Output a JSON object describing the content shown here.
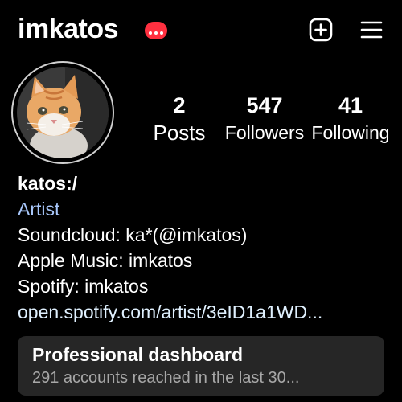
{
  "header": {
    "username": "imkatos",
    "create_icon": "plus-square-icon",
    "menu_icon": "hamburger-menu-icon",
    "badge_color": "#ff3040"
  },
  "profile": {
    "avatar_icon": "cat-avatar",
    "stats": {
      "posts": {
        "value": "2",
        "label": "Posts"
      },
      "followers": {
        "value": "547",
        "label": "Followers"
      },
      "following": {
        "value": "41",
        "label": "Following"
      }
    }
  },
  "bio": {
    "name": "katos:/",
    "category": "Artist",
    "lines": [
      "Soundcloud: ka*(@imkatos)",
      "Apple Music: imkatos",
      "Spotify: imkatos"
    ],
    "link": "open.spotify.com/artist/3eID1a1WD..."
  },
  "dashboard": {
    "title": "Professional dashboard",
    "subtitle": "291 accounts reached in the last 30..."
  }
}
